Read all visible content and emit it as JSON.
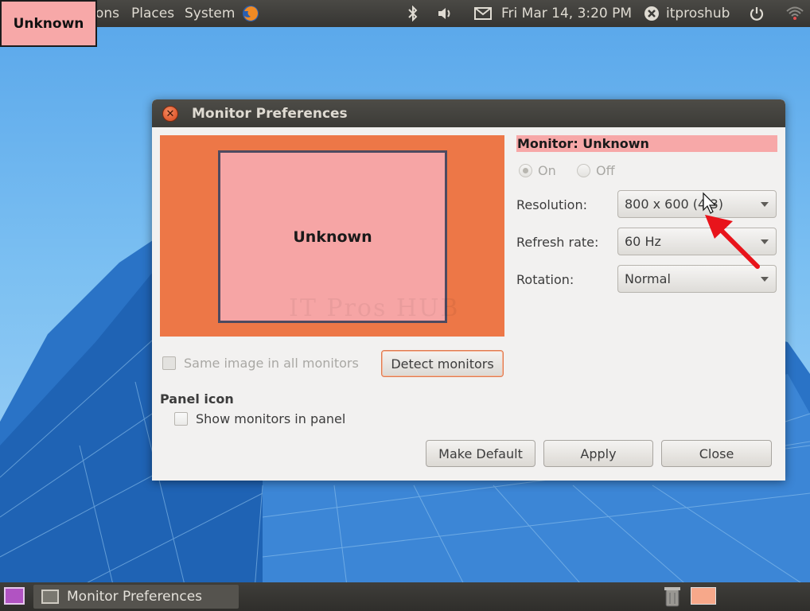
{
  "top_panel": {
    "active_label": "Unknown",
    "menus": [
      "ons",
      "Places",
      "System"
    ],
    "clock": "Fri Mar 14,  3:20 PM",
    "user": "itproshub"
  },
  "window": {
    "title": "Monitor Preferences",
    "preview_label": "Unknown",
    "monitor_label": "Monitor: Unknown",
    "power": {
      "on_label": "On",
      "off_label": "Off",
      "selected": "On"
    },
    "resolution": {
      "label": "Resolution:",
      "value": "800 x 600 (4:3)"
    },
    "refresh": {
      "label": "Refresh rate:",
      "value": "60 Hz"
    },
    "rotation": {
      "label": "Rotation:",
      "value": "Normal"
    },
    "same_image_label": "Same image in all monitors",
    "detect_label": "Detect monitors",
    "panel_icon_title": "Panel icon",
    "show_monitors_label": "Show monitors in panel",
    "buttons": {
      "make_default": "Make Default",
      "apply": "Apply",
      "close": "Close"
    },
    "watermark": "IT Pros HUB"
  },
  "taskbar": {
    "task_label": "Monitor Preferences"
  },
  "colors": {
    "highlight": "#f7a8a8",
    "preview_bg": "#ed7747",
    "annotation_arrow": "#e8141b",
    "panel_bg": "#3c3b37"
  },
  "icons": [
    "firefox-icon",
    "bluetooth-icon",
    "volume-icon",
    "mail-icon",
    "user-icon",
    "power-icon",
    "network-icon",
    "show-desktop-icon",
    "monitor-app-icon",
    "trash-icon",
    "workspace-icon"
  ]
}
